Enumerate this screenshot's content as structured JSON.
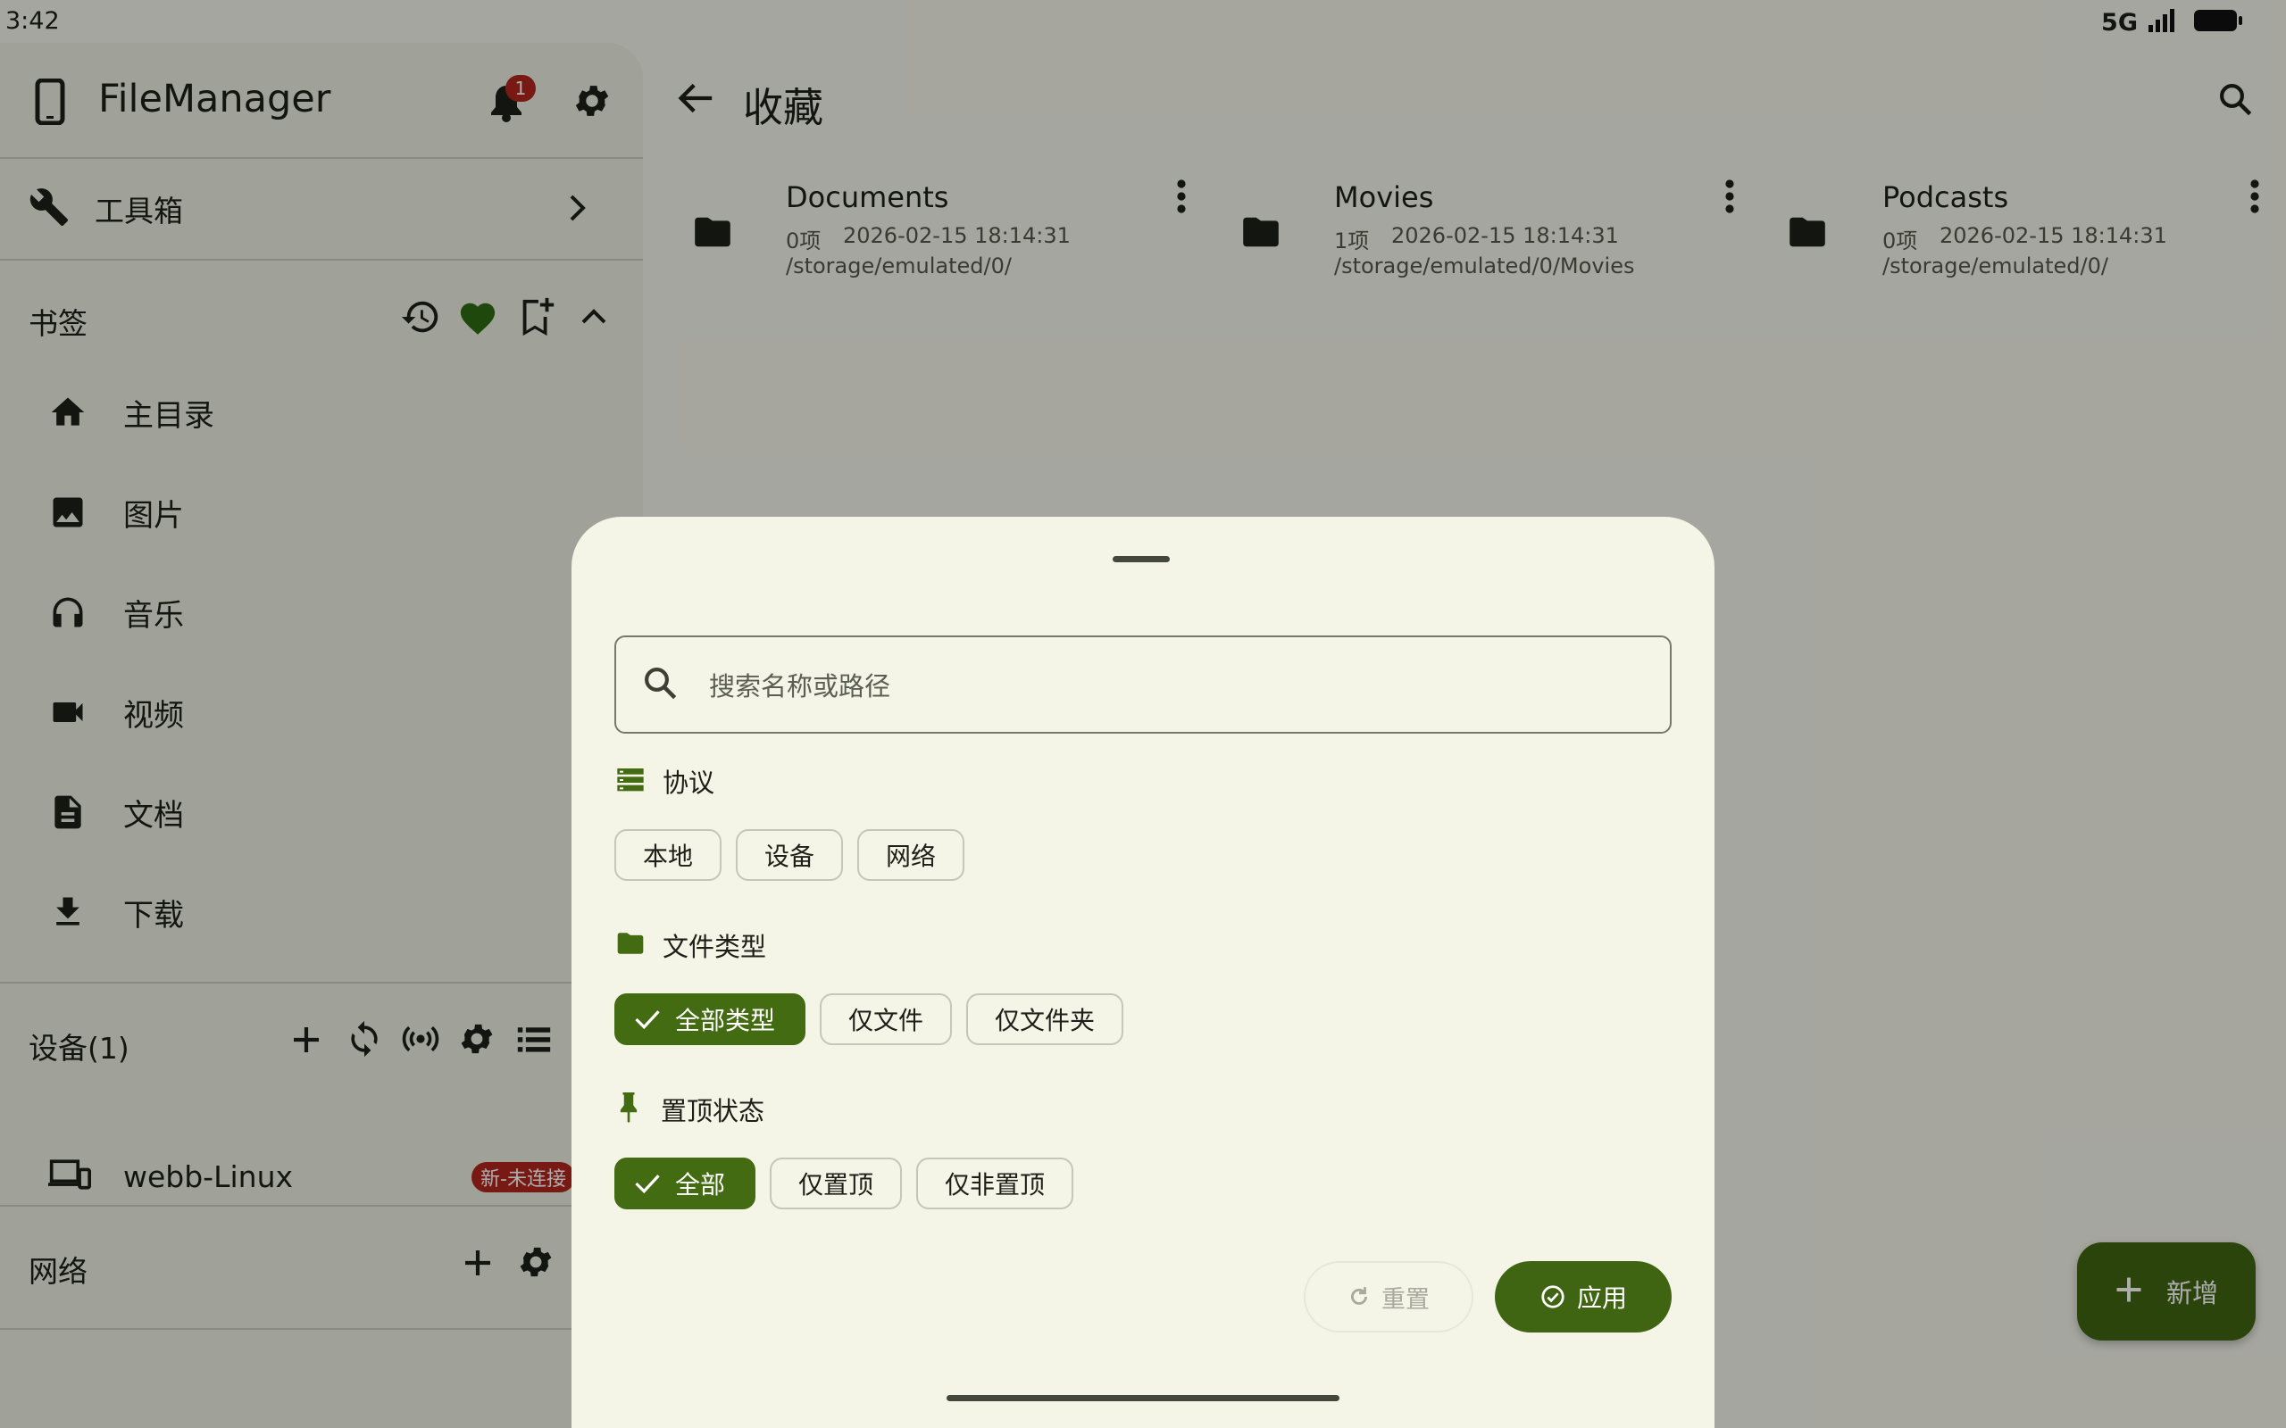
{
  "status_bar": {
    "time": "3:42",
    "network": "5G"
  },
  "sidebar": {
    "app_title": "FileManager",
    "notification_count": "1",
    "toolbox_label": "工具箱",
    "bookmarks_title": "书签",
    "bookmarks": [
      {
        "label": "主目录",
        "icon": "home-icon"
      },
      {
        "label": "图片",
        "icon": "image-icon"
      },
      {
        "label": "音乐",
        "icon": "headphones-icon"
      },
      {
        "label": "视频",
        "icon": "video-camera-icon"
      },
      {
        "label": "文档",
        "icon": "document-icon"
      },
      {
        "label": "下载",
        "icon": "download-icon"
      }
    ],
    "devices_title": "设备(1)",
    "device": {
      "name": "webb-Linux",
      "badge": "新-未连接"
    },
    "network_title": "网络"
  },
  "main": {
    "title": "收藏",
    "favorites": [
      {
        "name": "Documents",
        "count": "0项",
        "date": "2026-02-15 18:14:31",
        "path": "/storage/emulated/0/"
      },
      {
        "name": "Movies",
        "count": "1项",
        "date": "2026-02-15 18:14:31",
        "path": "/storage/emulated/0/Movies"
      },
      {
        "name": "Podcasts",
        "count": "0项",
        "date": "2026-02-15 18:14:31",
        "path": "/storage/emulated/0/"
      }
    ],
    "fab_label": "新增"
  },
  "sheet": {
    "search_placeholder": "搜索名称或路径",
    "protocol_title": "协议",
    "protocol_chips": [
      "本地",
      "设备",
      "网络"
    ],
    "filetype_title": "文件类型",
    "filetype_chips": [
      {
        "label": "全部类型",
        "selected": true
      },
      {
        "label": "仅文件",
        "selected": false
      },
      {
        "label": "仅文件夹",
        "selected": false
      }
    ],
    "pin_title": "置顶状态",
    "pin_chips": [
      {
        "label": "全部",
        "selected": true
      },
      {
        "label": "仅置顶",
        "selected": false
      },
      {
        "label": "仅非置顶",
        "selected": false
      }
    ],
    "reset_label": "重置",
    "apply_label": "应用"
  },
  "colors": {
    "accent": "#436b12",
    "badge_red": "#b3261e",
    "heart": "#2f6a12"
  }
}
